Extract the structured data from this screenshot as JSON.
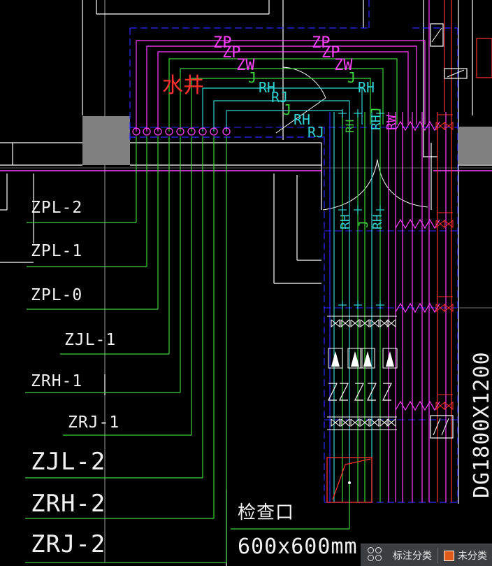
{
  "drawing": {
    "pipe_labels_left": [
      "ZPL-2",
      "ZPL-1",
      "ZPL-0",
      "ZJL-1",
      "ZRH-1",
      "ZRJ-1",
      "ZJL-2",
      "ZRH-2",
      "ZRJ-2"
    ],
    "room_label": "水井",
    "run_labels_magenta": [
      "ZP",
      "ZP",
      "ZP",
      "ZP",
      "ZW",
      "ZW"
    ],
    "run_labels_green": [
      "J",
      "J"
    ],
    "run_labels_cyan": [
      "RH",
      "RH",
      "RH",
      "RJ",
      "RJ"
    ],
    "riser_labels_vertical": [
      "RH",
      "J",
      "RH",
      "J",
      "RW",
      "RH",
      "J",
      "RH",
      "J"
    ],
    "note_inspection": "检查口",
    "note_inspection_size": "600x600mm",
    "duct_size_vertical": "DG1800X1200"
  },
  "colors": {
    "background": "#000000",
    "magenta": "#ff40ff",
    "green": "#3cd23c",
    "cyan": "#32d2d2",
    "blue": "#2a2aff",
    "red": "#ff3030",
    "white": "#ffffff",
    "wall_fill": "#808080",
    "toolbar_bg": "#3b3d40",
    "toolbar_swatch": "#e05a1a"
  },
  "toolbar": {
    "annotate_label": "标注分类",
    "unclassified_label": "未分类",
    "icon": "grid-circles-icon"
  }
}
